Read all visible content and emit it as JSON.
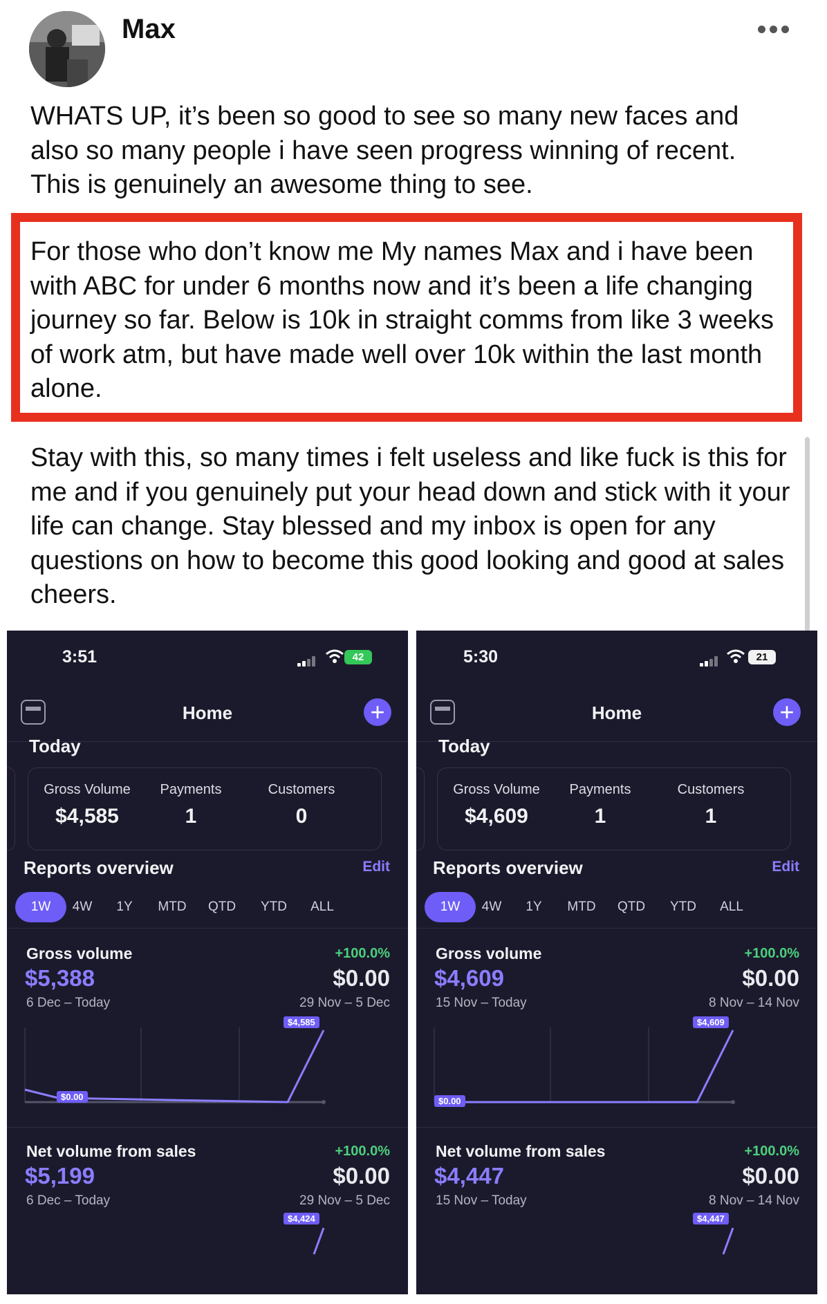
{
  "post": {
    "author": "Max",
    "paragraphs": [
      "WHATS UP, it’s been so good to see so many new faces and also so many people i have seen progress winning of recent. This is genuinely an awesome thing to see.",
      "For those who don’t know me My names Max and i have been with ABC for under 6 months now and it’s been a life changing journey so far.  Below is 10k in straight comms from like 3 weeks of work atm, but have made well over 10k within the last month alone.",
      "Stay with this, so many times i felt useless and like fuck is this for me and if you genuinely put your head down and stick with it your life can change. Stay blessed and my inbox is open for any questions on how to become this good looking and good at sales cheers."
    ],
    "highlight_color": "#e8301f"
  },
  "screenshots": [
    {
      "time": "3:51",
      "battery": "42",
      "nav_title": "Home",
      "today_label": "Today",
      "stats": [
        {
          "label": "Gross Volume",
          "value": "$4,585"
        },
        {
          "label": "Payments",
          "value": "1"
        },
        {
          "label": "Customers",
          "value": "0"
        }
      ],
      "reports_label": "Reports overview",
      "edit_label": "Edit",
      "ranges": [
        "1W",
        "4W",
        "1Y",
        "MTD",
        "QTD",
        "YTD",
        "ALL"
      ],
      "active_range": "1W",
      "gross": {
        "title": "Gross volume",
        "change": "+100.0%",
        "value": "$5,388",
        "prev": "$0.00",
        "range": "6 Dec – Today",
        "prev_range": "29 Nov – 5 Dec",
        "end_tag": "$4,585",
        "start_tag": "$0.00"
      },
      "net": {
        "title": "Net volume from sales",
        "change": "+100.0%",
        "value": "$5,199",
        "prev": "$0.00",
        "range": "6 Dec – Today",
        "prev_range": "29 Nov – 5 Dec",
        "end_tag": "$4,424"
      }
    },
    {
      "time": "5:30",
      "battery": "21",
      "nav_title": "Home",
      "today_label": "Today",
      "stats": [
        {
          "label": "Gross Volume",
          "value": "$4,609"
        },
        {
          "label": "Payments",
          "value": "1"
        },
        {
          "label": "Customers",
          "value": "1"
        }
      ],
      "reports_label": "Reports overview",
      "edit_label": "Edit",
      "ranges": [
        "1W",
        "4W",
        "1Y",
        "MTD",
        "QTD",
        "YTD",
        "ALL"
      ],
      "active_range": "1W",
      "gross": {
        "title": "Gross volume",
        "change": "+100.0%",
        "value": "$4,609",
        "prev": "$0.00",
        "range": "15 Nov – Today",
        "prev_range": "8 Nov – 14 Nov",
        "end_tag": "$4,609",
        "start_tag": "$0.00"
      },
      "net": {
        "title": "Net volume from sales",
        "change": "+100.0%",
        "value": "$4,447",
        "prev": "$0.00",
        "range": "15 Nov – Today",
        "prev_range": "8 Nov – 14 Nov",
        "end_tag": "$4,447"
      }
    }
  ],
  "colors": {
    "accent": "#6e5df6",
    "positive": "#4cd07d",
    "background_dark": "#1b1a2c"
  }
}
